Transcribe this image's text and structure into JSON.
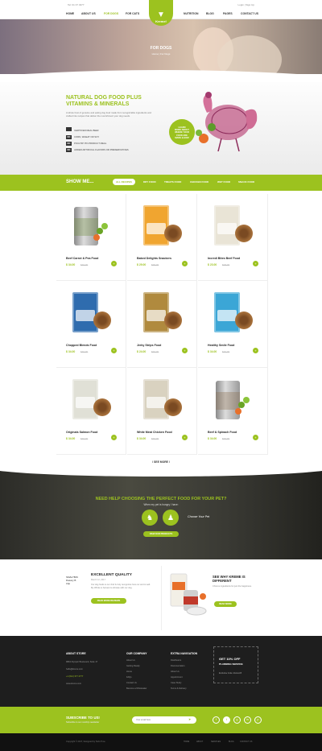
{
  "topbar": {
    "phone": "Tel: 01 37 4377",
    "right": "Login | Sign Up"
  },
  "nav": {
    "left": [
      "HOME",
      "ABOUT US",
      "FOR DOGS",
      "FOR CATS"
    ],
    "right": [
      "NUTRITION",
      "BLOG",
      "PAGES",
      "CONTACT US"
    ],
    "brand": "Kreme!"
  },
  "hero": {
    "title": "FOR DOGS",
    "breadcrumb": "Home | For Dogs"
  },
  "natural": {
    "title": "NATURAL DOG FOOD PLUS VITAMINS & MINERALS",
    "desc": "A whole host of genuine and eating dog food made from recognizable ingredients and crafted into recipes that deliver the nourishment your dog needs.",
    "items": [
      {
        "mark": "",
        "text": "CERTIFIED REAL BEEF"
      },
      {
        "mark": "NO",
        "text": "CORN, WHEAT OR SOY"
      },
      {
        "mark": "NO",
        "text": "POULTRY BY-PRODUCT MEAL"
      },
      {
        "mark": "NO",
        "text": "ADDED ARTIFICIAL FLAVORS OR PRESERVATIVES"
      }
    ],
    "badge": [
      "LEARN",
      "MORE ABOUT",
      "WHERE YOUR",
      "FOOD ARE",
      "MADE & HOW"
    ]
  },
  "filters": {
    "show": "SHOW ME...",
    "tabs": [
      "ALL RECIPES",
      "DRY FOOD",
      "TREATS FOOD",
      "CHICKEN FOOD",
      "WET FOOD",
      "SNACK FOOD"
    ],
    "active": "ALL RECIPES"
  },
  "products": [
    {
      "name": "Beef Carrot & Pea Food",
      "price": "$ 34.00",
      "old": "$40.00",
      "kind": "can",
      "color": "#6d8b3a"
    },
    {
      "name": "Baked Delights Snackers",
      "price": "$ 29.00",
      "old": "$35.00",
      "kind": "bag",
      "color": "#f0a530"
    },
    {
      "name": "Incredi Bites Beef Food",
      "price": "$ 23.00",
      "old": "$28.00",
      "kind": "bag",
      "color": "#e9e4d6"
    },
    {
      "name": "Chopped Blends Food",
      "price": "$ 34.00",
      "old": "$40.00",
      "kind": "bag",
      "color": "#2f6cae"
    },
    {
      "name": "Jerky Strips Food",
      "price": "$ 24.00",
      "old": "$30.00",
      "kind": "bag",
      "color": "#b08a3e"
    },
    {
      "name": "Healthy Smile Food",
      "price": "$ 34.00",
      "old": "$40.00",
      "kind": "bag",
      "color": "#3ba6d6"
    },
    {
      "name": "Originals Salmon Food",
      "price": "$ 34.00",
      "old": "$40.00",
      "kind": "bag",
      "color": "#e0e0d6"
    },
    {
      "name": "White Meat Chicken Food",
      "price": "$ 34.00",
      "old": "$40.00",
      "kind": "bag",
      "color": "#d9d2c0"
    },
    {
      "name": "Beef & Spinach Food",
      "price": "$ 34.00",
      "old": "$40.00",
      "kind": "can",
      "color": "#8a6b4a"
    }
  ],
  "see_more": "/ SEE MORE /",
  "help": {
    "title": "NEED HELP CHOOSING THE PERFECT FOOD FOR YOUR PET?",
    "sub": "When my pet is hungry I have:",
    "choose": "Choose Your Pet",
    "button": "VIEW OUR PRODUCTS"
  },
  "quality": {
    "label": "SMALTBIN Dietary B Clip",
    "title": "EXCELLENT QUALITY",
    "date": "March 12, 2017",
    "text": "Our dog foods is our chef & truly recognizes how our and is well. My Whole is harvest is ultimate with our dog.",
    "button": "READ MORE REVIEWS",
    "title2": "SEE WHY KREME IS DIFFERENT",
    "text2": "Chrome ingredients for just the happiness.",
    "button2": "READ MORE"
  },
  "footer": {
    "about": {
      "title": "ABOUT STORE",
      "lines": [
        "9834 Olympic Boulevard, Suite 17",
        "hello@kreme.com",
        "+1 (012) 377 4777",
        "www.kreme.com"
      ]
    },
    "company": {
      "title": "OUR COMPANY",
      "lines": [
        "About Us",
        "Getting Ready",
        "Home",
        "FAQs",
        "Contact Us",
        "Become a Wholesaler"
      ]
    },
    "extra": {
      "title": "EXTRA NAVIGATION",
      "lines": [
        "Distributors",
        "Documentation",
        "About Us",
        "Appointment",
        "Case Study",
        "Terms & Delivery"
      ]
    },
    "offer": {
      "a": "GET 10% OFF",
      "b": "PLANNING SERVICE",
      "c": "Exclusive Code: discount5"
    }
  },
  "subscribe": {
    "title": "SUBSCRIBE TO US!",
    "sub": "Subscribe to our monthly newsletter",
    "placeholder": "Your email here",
    "socials": [
      "f",
      "t",
      "g",
      "in",
      "p"
    ]
  },
  "bottom": {
    "copyright": "Copyright © 2017, Designed by Tedo Time",
    "links": [
      "HOME",
      "ABOUT",
      "SERVICES",
      "BLOG",
      "CONTACT US"
    ]
  }
}
